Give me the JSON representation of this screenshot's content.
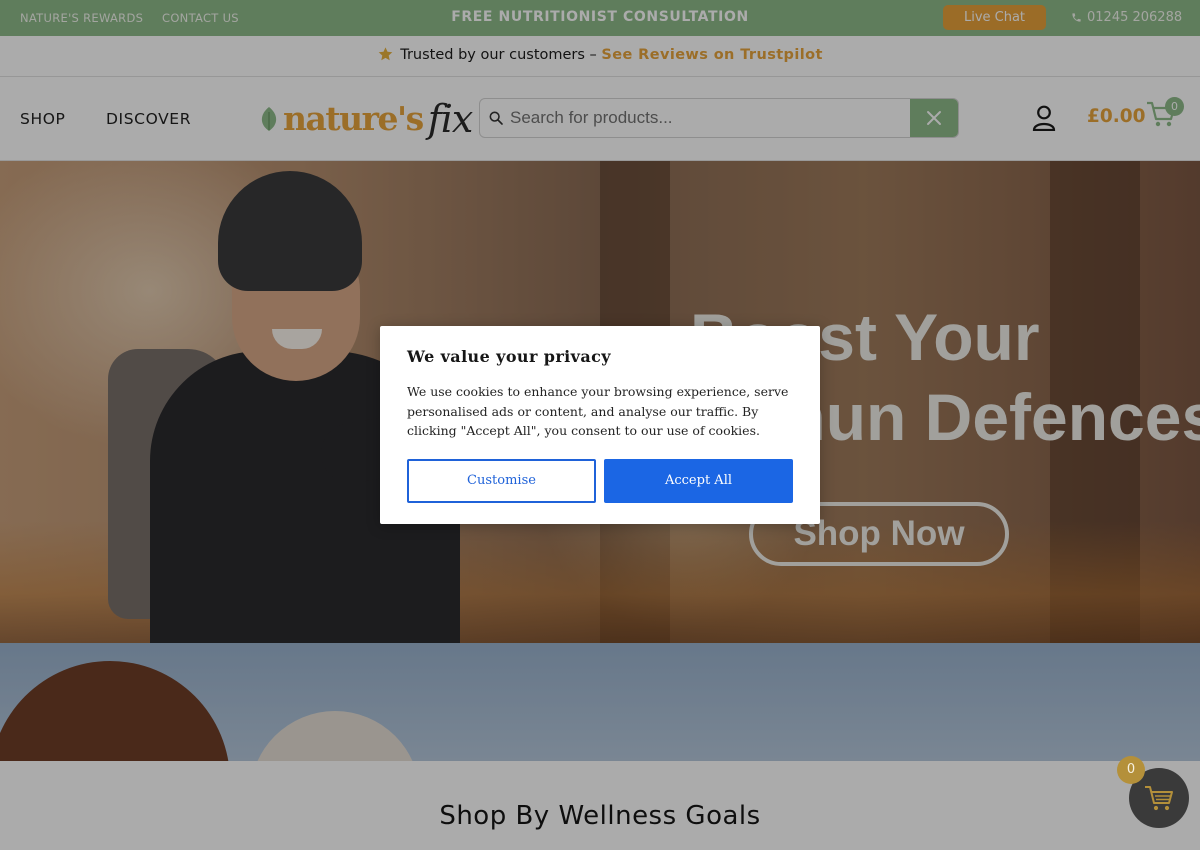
{
  "topbar": {
    "rewards": "NATURE'S REWARDS",
    "contact": "CONTACT US",
    "promo": "FREE NUTRITIONIST CONSULTATION",
    "live_chat": "Live Chat",
    "phone": "01245 206288"
  },
  "trustbar": {
    "text": "Trusted by our customers – ",
    "link": "See Reviews on Trustpilot"
  },
  "header": {
    "nav": [
      "SHOP",
      "DISCOVER"
    ],
    "logo_main": "nature's",
    "logo_fix": "fix",
    "search_placeholder": "Search for products...",
    "cart_total": "£0.00",
    "cart_count": "0"
  },
  "hero": {
    "headline_line1": "Boost Your",
    "headline_line2": "Immun Defences",
    "cta": "Shop Now"
  },
  "wellness": {
    "title": "Shop By Wellness Goals"
  },
  "cookie_modal": {
    "title": "We value your privacy",
    "body": "We use cookies to enhance your browsing experience, serve personalised ads or content, and analyse our traffic. By clicking \"Accept All\", you consent to our use of cookies.",
    "customise": "Customise",
    "accept_all": "Accept All"
  },
  "floating_cart": {
    "count": "0"
  },
  "colors": {
    "brand_green": "#8ebb8a",
    "brand_orange": "#e8a43d",
    "accept_blue": "#1b66e4"
  },
  "icons": {
    "trust": "star-icon",
    "phone": "phone-icon",
    "search": "search-icon",
    "clear": "close-icon",
    "account": "user-icon",
    "cart": "cart-icon",
    "logo_leaf": "leaf-icon"
  }
}
